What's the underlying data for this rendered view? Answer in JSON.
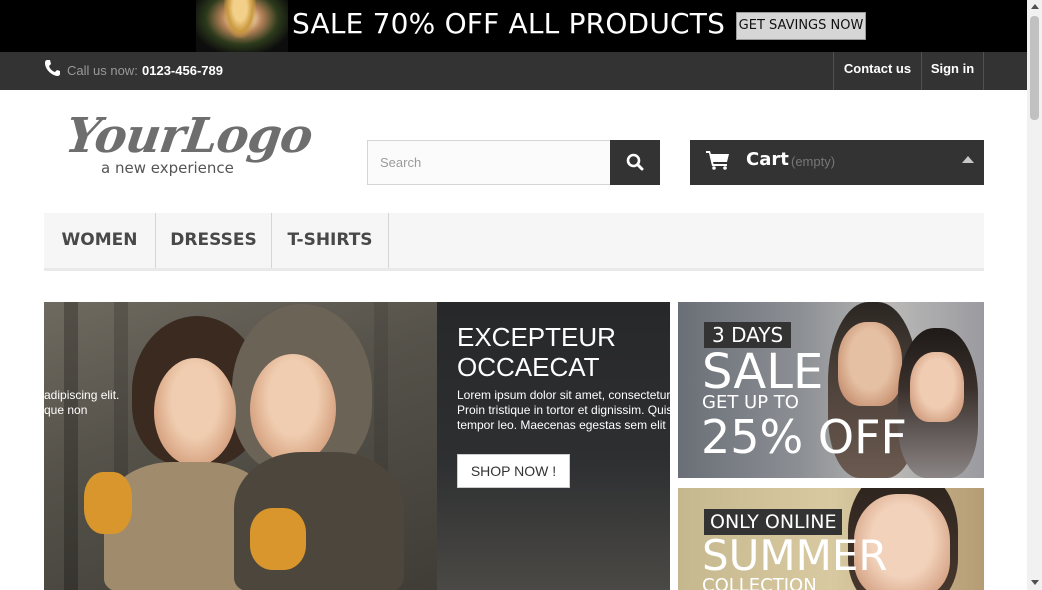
{
  "promo": {
    "title": "SALE 70% OFF ALL PRODUCTS",
    "button_label": "GET SAVINGS NOW"
  },
  "navbar": {
    "call_label": "Call us now:",
    "phone": "0123-456-789",
    "contact_label": "Contact us",
    "signin_label": "Sign in"
  },
  "header": {
    "logo_text": "YourLogo",
    "logo_tagline": "a new experience",
    "search_placeholder": "Search",
    "cart_label": "Cart",
    "cart_status": "(empty)"
  },
  "menu": {
    "items": [
      {
        "label": "WOMEN"
      },
      {
        "label": "DRESSES"
      },
      {
        "label": "T-SHIRTS"
      }
    ]
  },
  "slider": {
    "ghost_text": "adipiscing elit.\nque non",
    "title": "EXCEPTEUR\nOCCAECAT",
    "text": "Lorem ipsum dolor sit amet, consectetur\nProin tristique in tortor et dignissim. Quis\ntempor leo. Maecenas egestas sem elit",
    "button_label": "SHOP NOW !"
  },
  "banners": {
    "sale": {
      "badge": "3 DAYS",
      "headline": "SALE",
      "sub": "GET UP TO",
      "percent": "25% OFF"
    },
    "summer": {
      "badge": "ONLY ONLINE",
      "headline": "SUMMER",
      "sub": "COLLECTION"
    }
  },
  "icons": {
    "phone": "phone-icon",
    "search": "search-icon",
    "cart": "cart-icon",
    "caret": "caret-up-icon"
  },
  "colors": {
    "dark": "#333333",
    "menu_bg": "#f6f6f6",
    "promo_bg": "#000000"
  }
}
